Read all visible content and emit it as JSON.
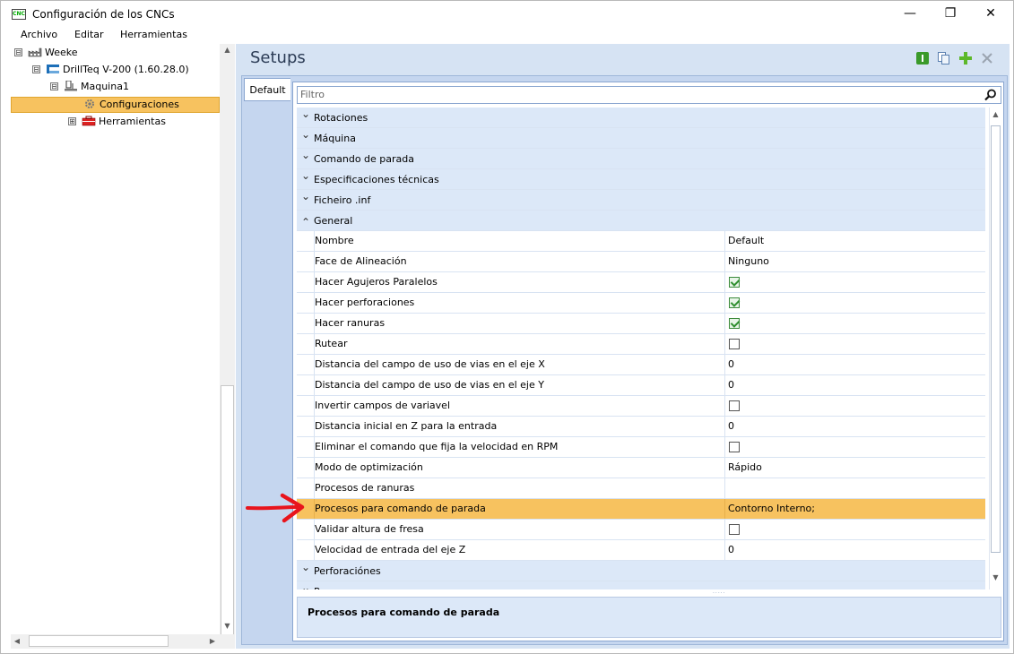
{
  "window": {
    "title": "Configuración de los CNCs",
    "app_icon_text": "CNC",
    "minimize": "—",
    "maximize": "❐",
    "close": "✕"
  },
  "menu": [
    "Archivo",
    "Editar",
    "Herramientas"
  ],
  "tree": {
    "items": [
      {
        "label": "Weeke",
        "expander": "⊟",
        "icon": "factory-icon"
      },
      {
        "label": "DrillTeq V-200 (1.60.28.0)",
        "expander": "⊟",
        "icon": "machine-icon"
      },
      {
        "label": "Maquina1",
        "expander": "⊟",
        "icon": "machine-tool-icon"
      },
      {
        "label": "Configuraciones",
        "expander": "",
        "icon": "gear-icon",
        "selected": true
      },
      {
        "label": "Herramientas",
        "expander": "⊞",
        "icon": "toolbox-icon"
      }
    ]
  },
  "panel": {
    "title": "Setups",
    "tab": "Default",
    "filter_placeholder": "Filtro",
    "description": "Procesos para comando de parada"
  },
  "grid": {
    "rows": [
      {
        "kind": "cat",
        "label": "Rotaciones",
        "expanded": false
      },
      {
        "kind": "cat",
        "label": "Máquina",
        "expanded": false
      },
      {
        "kind": "cat",
        "label": "Comando de parada",
        "expanded": false
      },
      {
        "kind": "cat",
        "label": "Especificaciones técnicas",
        "expanded": false
      },
      {
        "kind": "cat",
        "label": "Ficheiro .inf",
        "expanded": false
      },
      {
        "kind": "cat",
        "label": "General",
        "expanded": true
      },
      {
        "kind": "prop",
        "name": "Nombre",
        "value": "Default"
      },
      {
        "kind": "prop",
        "name": "Face de Alineación",
        "value": "Ninguno"
      },
      {
        "kind": "prop",
        "name": "Hacer Agujeros Paralelos",
        "checkbox": true,
        "checked": true
      },
      {
        "kind": "prop",
        "name": "Hacer perforaciones",
        "checkbox": true,
        "checked": true
      },
      {
        "kind": "prop",
        "name": "Hacer ranuras",
        "checkbox": true,
        "checked": true
      },
      {
        "kind": "prop",
        "name": "Rutear",
        "checkbox": true,
        "checked": false
      },
      {
        "kind": "prop",
        "name": "Distancia del campo de uso de vias en el eje X",
        "value": "0"
      },
      {
        "kind": "prop",
        "name": "Distancia del campo de uso de vias en el eje Y",
        "value": "0"
      },
      {
        "kind": "prop",
        "name": "Invertir campos de variavel",
        "checkbox": true,
        "checked": false
      },
      {
        "kind": "prop",
        "name": "Distancia inicial en Z para la entrada",
        "value": "0"
      },
      {
        "kind": "prop",
        "name": "Eliminar el comando que fija la velocidad en RPM",
        "checkbox": true,
        "checked": false
      },
      {
        "kind": "prop",
        "name": "Modo de optimización",
        "value": "Rápido"
      },
      {
        "kind": "prop",
        "name": "Procesos de ranuras",
        "value": ""
      },
      {
        "kind": "prop",
        "name": "Procesos para comando de parada",
        "value": "Contorno Interno;",
        "highlighted": true
      },
      {
        "kind": "prop",
        "name": "Validar altura de fresa",
        "checkbox": true,
        "checked": false
      },
      {
        "kind": "prop",
        "name": "Velocidad de entrada del eje Z",
        "value": "0"
      },
      {
        "kind": "cat",
        "label": "Perforaciónes",
        "expanded": false
      },
      {
        "kind": "cat",
        "label": "Ranuras",
        "expanded": false
      }
    ]
  },
  "colors": {
    "selection": "#f7c25f",
    "category_bg": "#dce8f8",
    "annotation_arrow": "#e8141c"
  }
}
